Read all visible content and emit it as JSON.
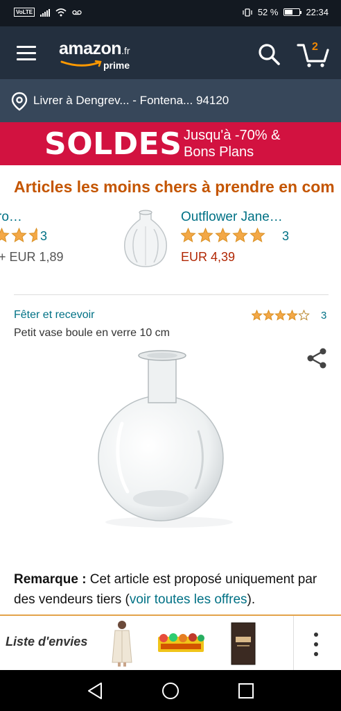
{
  "status_bar": {
    "carrier_badge": "VoLTE",
    "battery": "52 %",
    "time": "22:34",
    "battery_level": 0.52
  },
  "header": {
    "logo_text": "amazon",
    "logo_tld": ".fr",
    "logo_sub": "prime",
    "cart_count": "2",
    "icons": [
      "menu-icon",
      "search-icon",
      "cart-icon"
    ]
  },
  "delivery": {
    "text": "Livrer à Dengrev... - Fontena... 94120"
  },
  "banner": {
    "title": "SOLDES",
    "line1": "Jusqu'à -70% &",
    "line2": "Bons Plans"
  },
  "carousel": {
    "title": "Articles les moins chers à prendre en com",
    "items": [
      {
        "title": "ro…",
        "rating_count": "3",
        "price": "+ EUR 1,89",
        "stars": 5
      },
      {
        "title": "Outflower Jane…",
        "rating_count": "3",
        "price": "EUR 4,39",
        "stars": 5
      }
    ]
  },
  "product": {
    "brand": "Fêter et recevoir",
    "rating_count": "3",
    "stars": 4,
    "title": "Petit vase boule en verre 10 cm"
  },
  "remark": {
    "label": "Remarque :",
    "text": " Cet article est proposé uniquement par des vendeurs tiers (",
    "link": "voir toutes les offres",
    "end": ")."
  },
  "wishlist": {
    "label": "Liste d'envies"
  },
  "colors": {
    "header_bg": "#232f3e",
    "delivery_bg": "#37475a",
    "banner_bg": "#d21240",
    "title_orange": "#c45500",
    "link_teal": "#007185",
    "price_red": "#b12704",
    "star": "#f3a847"
  }
}
